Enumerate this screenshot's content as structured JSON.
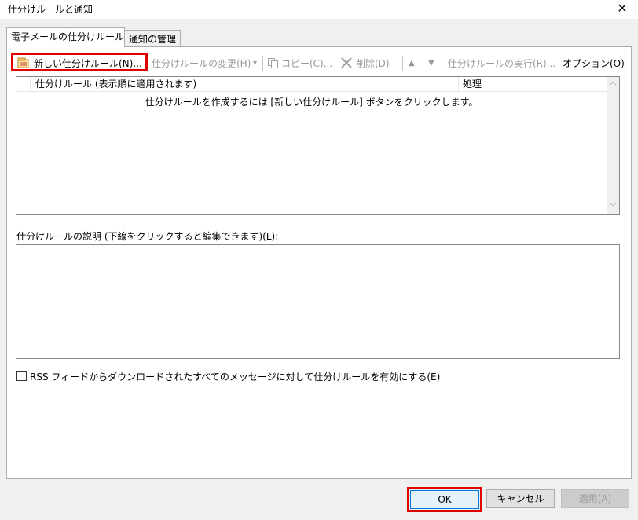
{
  "window": {
    "title": "仕分けルールと通知",
    "close_glyph": "✕"
  },
  "tabs": [
    {
      "label": "電子メールの仕分けルール",
      "selected": true
    },
    {
      "label": "通知の管理",
      "selected": false
    }
  ],
  "toolbar": {
    "new_rule": "新しい仕分けルール(N)...",
    "change_rule": "仕分けルールの変更(H)",
    "change_arrow": "▾",
    "copy": "コピー(C)...",
    "delete": "削除(D)",
    "move_up": "▲",
    "move_down": "▼",
    "run_rules": "仕分けルールの実行(R)...",
    "options": "オプション(O)"
  },
  "rules_list": {
    "columns": [
      "仕分けルール (表示順に適用されます)",
      "処理"
    ],
    "empty_message": "仕分けルールを作成するには [新しい仕分けルール] ボタンをクリックします。",
    "scroll_up": "︿",
    "scroll_down": "﹀"
  },
  "description": {
    "label": "仕分けルールの説明 (下線をクリックすると編集できます)(L):"
  },
  "rss_checkbox": {
    "label": "RSS フィードからダウンロードされたすべてのメッセージに対して仕分けルールを有効にする(E)",
    "checked": false
  },
  "buttons": {
    "ok": "OK",
    "cancel": "キャンセル",
    "apply": "適用(A)"
  },
  "colors": {
    "highlight": "#e00000",
    "focus": "#0078d7",
    "disabled_text": "#9a9a9a"
  }
}
